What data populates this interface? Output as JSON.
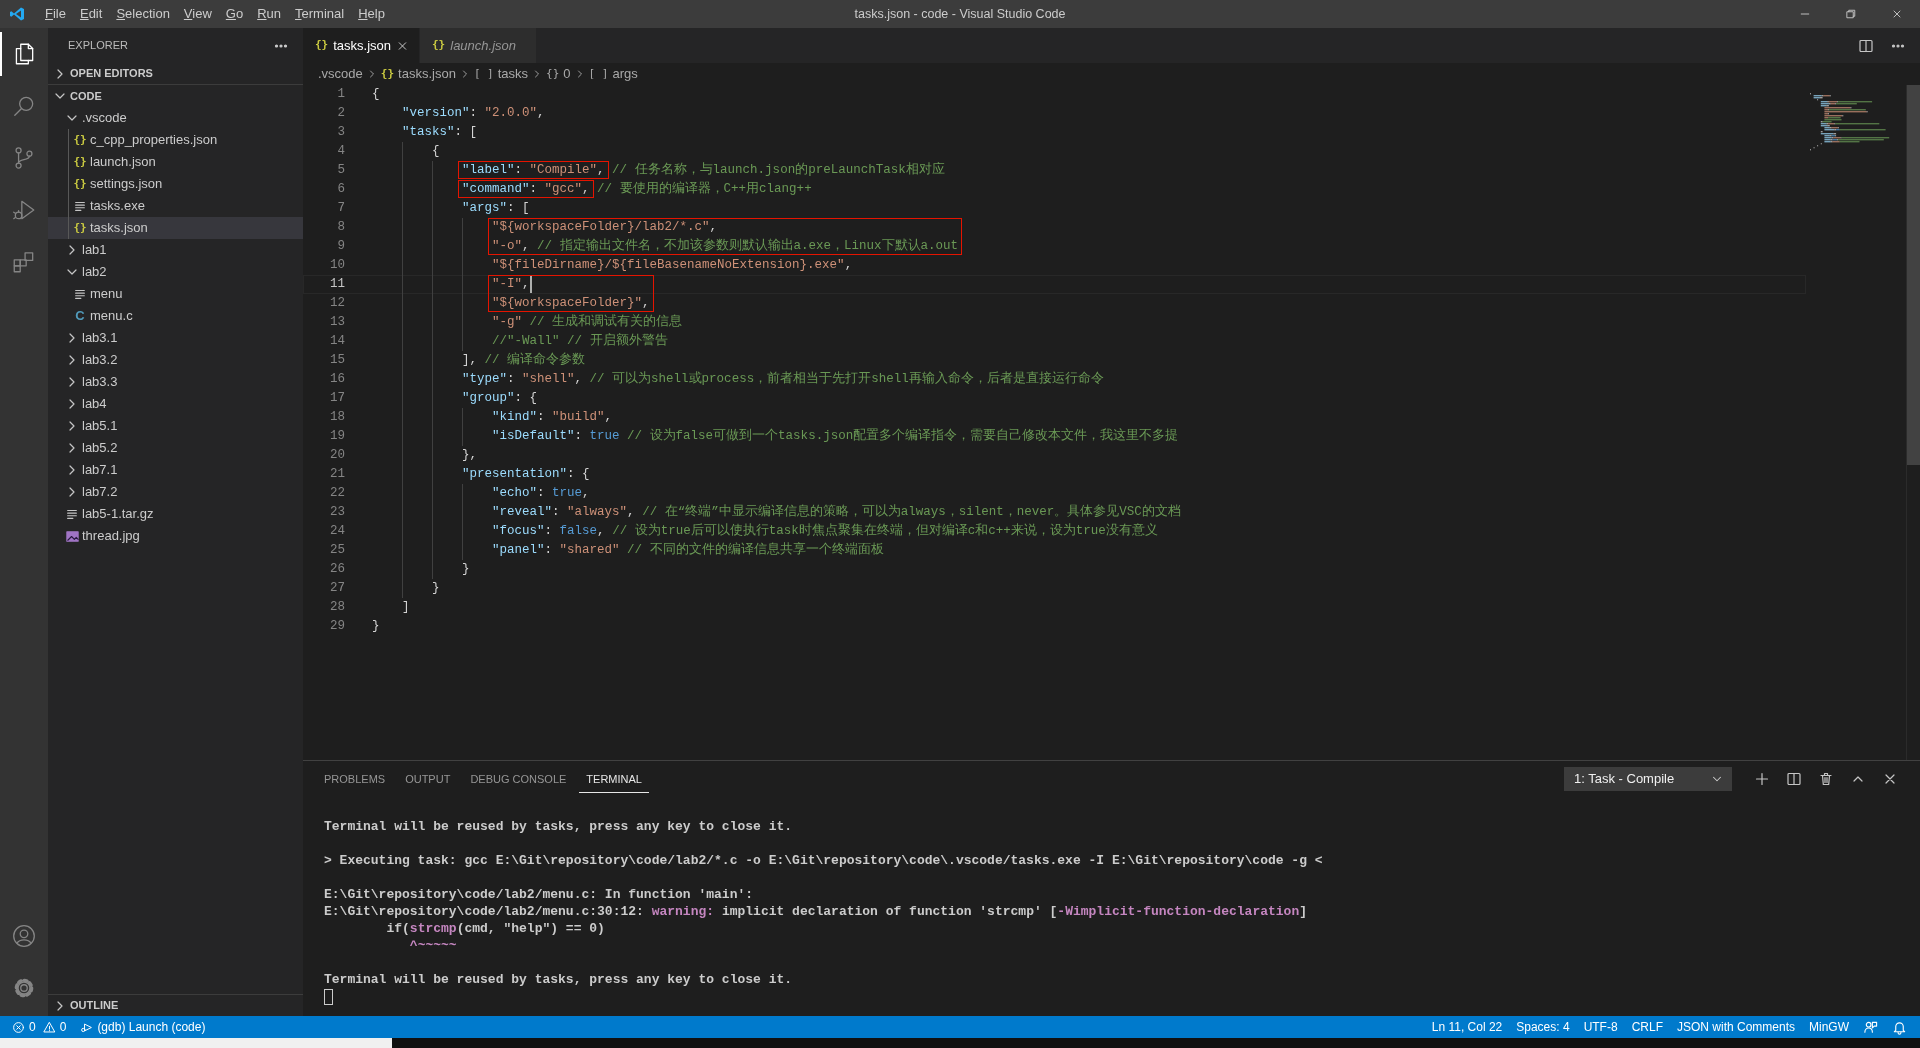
{
  "window": {
    "title": "tasks.json - code - Visual Studio Code"
  },
  "menu": [
    "File",
    "Edit",
    "Selection",
    "View",
    "Go",
    "Run",
    "Terminal",
    "Help"
  ],
  "activity_bar": [
    {
      "kind": "explorer",
      "selected": true
    },
    {
      "kind": "search",
      "selected": false
    },
    {
      "kind": "source-control",
      "selected": false
    },
    {
      "kind": "run",
      "selected": false
    },
    {
      "kind": "extensions",
      "selected": false
    }
  ],
  "activity_bar_bottom": [
    {
      "kind": "account"
    },
    {
      "kind": "settings"
    }
  ],
  "sidebar": {
    "title": "EXPLORER",
    "sections": [
      {
        "title": "OPEN EDITORS",
        "expanded": false
      },
      {
        "title": "CODE",
        "expanded": true,
        "items": [
          {
            "kind": "folder",
            "label": ".vscode",
            "expanded": true,
            "selected": false,
            "children": [
              {
                "kind": "json",
                "icon": "{}",
                "label": "c_cpp_properties.json",
                "selected": false
              },
              {
                "kind": "json",
                "icon": "{}",
                "label": "launch.json",
                "selected": false
              },
              {
                "kind": "json",
                "icon": "{}",
                "label": "settings.json",
                "selected": false
              },
              {
                "kind": "text",
                "label": "tasks.exe",
                "selected": false
              },
              {
                "kind": "json",
                "icon": "{}",
                "label": "tasks.json",
                "selected": true
              }
            ]
          },
          {
            "kind": "folder",
            "label": "lab1",
            "expanded": false,
            "selected": false
          },
          {
            "kind": "folder",
            "label": "lab2",
            "expanded": true,
            "selected": false,
            "children": [
              {
                "kind": "text",
                "label": "menu",
                "selected": false
              },
              {
                "kind": "c",
                "icon": "C",
                "label": "menu.c",
                "selected": false
              }
            ]
          },
          {
            "kind": "folder",
            "label": "lab3.1",
            "expanded": false,
            "selected": false
          },
          {
            "kind": "folder",
            "label": "lab3.2",
            "expanded": false,
            "selected": false
          },
          {
            "kind": "folder",
            "label": "lab3.3",
            "expanded": false,
            "selected": false
          },
          {
            "kind": "folder",
            "label": "lab4",
            "expanded": false,
            "selected": false
          },
          {
            "kind": "folder",
            "label": "lab5.1",
            "expanded": false,
            "selected": false
          },
          {
            "kind": "folder",
            "label": "lab5.2",
            "expanded": false,
            "selected": false
          },
          {
            "kind": "folder",
            "label": "lab7.1",
            "expanded": false,
            "selected": false
          },
          {
            "kind": "folder",
            "label": "lab7.2",
            "expanded": false,
            "selected": false
          },
          {
            "kind": "text",
            "label": "lab5-1.tar.gz",
            "selected": false
          },
          {
            "kind": "image",
            "label": "thread.jpg",
            "selected": false
          }
        ]
      }
    ],
    "bottom_section": {
      "title": "OUTLINE",
      "expanded": false
    }
  },
  "tabs": [
    {
      "icon": "{}",
      "label": "tasks.json",
      "selected": true,
      "preview": false
    },
    {
      "icon": "{}",
      "label": "launch.json",
      "selected": false,
      "preview": true
    }
  ],
  "breadcrumbs": [
    {
      "kind": "folder",
      "label": ".vscode"
    },
    {
      "kind": "json",
      "icon": "{}",
      "label": "tasks.json"
    },
    {
      "kind": "array",
      "icon": "[ ]",
      "label": "tasks"
    },
    {
      "kind": "object",
      "icon": "{}",
      "label": "0"
    },
    {
      "kind": "array",
      "icon": "[ ]",
      "label": "args"
    }
  ],
  "editor": {
    "lines": [
      {
        "number": "1",
        "current": false,
        "boxed": false,
        "tokens": [
          {
            "kind": "punct",
            "text": "{"
          }
        ]
      },
      {
        "number": "2",
        "current": false,
        "boxed": false,
        "tokens": [
          {
            "kind": "key",
            "text": "    \"version\""
          },
          {
            "kind": "punct",
            "text": ": "
          },
          {
            "kind": "string",
            "text": "\"2.0.0\""
          },
          {
            "kind": "punct",
            "text": ","
          }
        ]
      },
      {
        "number": "3",
        "current": false,
        "boxed": false,
        "tokens": [
          {
            "kind": "key",
            "text": "    \"tasks\""
          },
          {
            "kind": "punct",
            "text": ": ["
          }
        ]
      },
      {
        "number": "4",
        "current": false,
        "boxed": false,
        "tokens": [
          {
            "kind": "punct",
            "text": "        {"
          }
        ]
      },
      {
        "number": "5",
        "current": false,
        "boxed": true,
        "box_continues": false,
        "box_covers_comment": false,
        "tokens": [
          {
            "kind": "key",
            "text": "            \"label\""
          },
          {
            "kind": "punct",
            "text": ": "
          },
          {
            "kind": "string",
            "text": "\"Compile\""
          },
          {
            "kind": "punct",
            "text": ","
          },
          {
            "kind": "comment",
            "text": " // 任务名称，与launch.json的preLaunchTask相对应"
          }
        ]
      },
      {
        "number": "6",
        "current": false,
        "boxed": true,
        "box_continues": false,
        "box_covers_comment": false,
        "tokens": [
          {
            "kind": "key",
            "text": "            \"command\""
          },
          {
            "kind": "punct",
            "text": ": "
          },
          {
            "kind": "string",
            "text": "\"gcc\""
          },
          {
            "kind": "punct",
            "text": ","
          },
          {
            "kind": "comment",
            "text": " // 要使用的编译器，C++用clang++"
          }
        ]
      },
      {
        "number": "7",
        "current": false,
        "boxed": false,
        "tokens": [
          {
            "kind": "key",
            "text": "            \"args\""
          },
          {
            "kind": "punct",
            "text": ": ["
          }
        ]
      },
      {
        "number": "8",
        "current": false,
        "boxed": true,
        "box_continues": false,
        "tokens": [
          {
            "kind": "string",
            "text": "                \"${workspaceFolder}/lab2/*.c\""
          },
          {
            "kind": "punct",
            "text": ","
          }
        ]
      },
      {
        "number": "9",
        "current": false,
        "boxed": true,
        "box_continues": true,
        "box_covers_comment": true,
        "tokens": [
          {
            "kind": "string",
            "text": "                \"-o\""
          },
          {
            "kind": "punct",
            "text": ","
          },
          {
            "kind": "comment",
            "text": " // 指定输出文件名，不加该参数则默认输出a.exe，Linux下默认a.out"
          }
        ]
      },
      {
        "number": "10",
        "current": false,
        "boxed": false,
        "tokens": [
          {
            "kind": "string",
            "text": "                \"${fileDirname}/${fileBasenameNoExtension}.exe\""
          },
          {
            "kind": "punct",
            "text": ","
          }
        ]
      },
      {
        "number": "11",
        "current": true,
        "boxed": true,
        "box_continues": false,
        "tokens": [
          {
            "kind": "string",
            "text": "                \"-I\""
          },
          {
            "kind": "punct",
            "text": ","
          }
        ]
      },
      {
        "number": "12",
        "current": false,
        "boxed": true,
        "box_continues": true,
        "tokens": [
          {
            "kind": "string",
            "text": "                \"${workspaceFolder}\""
          },
          {
            "kind": "punct",
            "text": ","
          }
        ]
      },
      {
        "number": "13",
        "current": false,
        "boxed": false,
        "tokens": [
          {
            "kind": "string",
            "text": "                \"-g\""
          },
          {
            "kind": "comment",
            "text": " // 生成和调试有关的信息"
          }
        ]
      },
      {
        "number": "14",
        "current": false,
        "boxed": false,
        "tokens": [
          {
            "kind": "comment",
            "text": "                //\"-Wall\" // 开启额外警告"
          }
        ]
      },
      {
        "number": "15",
        "current": false,
        "boxed": false,
        "tokens": [
          {
            "kind": "punct",
            "text": "            ],"
          },
          {
            "kind": "comment",
            "text": " // 编译命令参数"
          }
        ]
      },
      {
        "number": "16",
        "current": false,
        "boxed": false,
        "tokens": [
          {
            "kind": "key",
            "text": "            \"type\""
          },
          {
            "kind": "punct",
            "text": ": "
          },
          {
            "kind": "string",
            "text": "\"shell\""
          },
          {
            "kind": "punct",
            "text": ","
          },
          {
            "kind": "comment",
            "text": " // 可以为shell或process，前者相当于先打开shell再输入命令，后者是直接运行命令"
          }
        ]
      },
      {
        "number": "17",
        "current": false,
        "boxed": false,
        "tokens": [
          {
            "kind": "key",
            "text": "            \"group\""
          },
          {
            "kind": "punct",
            "text": ": {"
          }
        ]
      },
      {
        "number": "18",
        "current": false,
        "boxed": false,
        "tokens": [
          {
            "kind": "key",
            "text": "                \"kind\""
          },
          {
            "kind": "punct",
            "text": ": "
          },
          {
            "kind": "string",
            "text": "\"build\""
          },
          {
            "kind": "punct",
            "text": ","
          }
        ]
      },
      {
        "number": "19",
        "current": false,
        "boxed": false,
        "tokens": [
          {
            "kind": "key",
            "text": "                \"isDefault\""
          },
          {
            "kind": "punct",
            "text": ": "
          },
          {
            "kind": "literal",
            "text": "true"
          },
          {
            "kind": "comment",
            "text": " // 设为false可做到一个tasks.json配置多个编译指令，需要自己修改本文件，我这里不多提"
          }
        ]
      },
      {
        "number": "20",
        "current": false,
        "boxed": false,
        "tokens": [
          {
            "kind": "punct",
            "text": "            },"
          }
        ]
      },
      {
        "number": "21",
        "current": false,
        "boxed": false,
        "tokens": [
          {
            "kind": "key",
            "text": "            \"presentation\""
          },
          {
            "kind": "punct",
            "text": ": {"
          }
        ]
      },
      {
        "number": "22",
        "current": false,
        "boxed": false,
        "tokens": [
          {
            "kind": "key",
            "text": "                \"echo\""
          },
          {
            "kind": "punct",
            "text": ": "
          },
          {
            "kind": "literal",
            "text": "true"
          },
          {
            "kind": "punct",
            "text": ","
          }
        ]
      },
      {
        "number": "23",
        "current": false,
        "boxed": false,
        "tokens": [
          {
            "kind": "key",
            "text": "                \"reveal\""
          },
          {
            "kind": "punct",
            "text": ": "
          },
          {
            "kind": "string",
            "text": "\"always\""
          },
          {
            "kind": "punct",
            "text": ","
          },
          {
            "kind": "comment",
            "text": " // 在“终端”中显示编译信息的策略，可以为always，silent，never。具体参见VSC的文档"
          }
        ]
      },
      {
        "number": "24",
        "current": false,
        "boxed": false,
        "tokens": [
          {
            "kind": "key",
            "text": "                \"focus\""
          },
          {
            "kind": "punct",
            "text": ": "
          },
          {
            "kind": "literal",
            "text": "false"
          },
          {
            "kind": "punct",
            "text": ","
          },
          {
            "kind": "comment",
            "text": " // 设为true后可以使执行task时焦点聚集在终端，但对编译c和c++来说，设为true没有意义"
          }
        ]
      },
      {
        "number": "25",
        "current": false,
        "boxed": false,
        "tokens": [
          {
            "kind": "key",
            "text": "                \"panel\""
          },
          {
            "kind": "punct",
            "text": ": "
          },
          {
            "kind": "string",
            "text": "\"shared\""
          },
          {
            "kind": "comment",
            "text": " // 不同的文件的编译信息共享一个终端面板"
          }
        ]
      },
      {
        "number": "26",
        "current": false,
        "boxed": false,
        "tokens": [
          {
            "kind": "punct",
            "text": "            }"
          }
        ]
      },
      {
        "number": "27",
        "current": false,
        "boxed": false,
        "tokens": [
          {
            "kind": "punct",
            "text": "        }"
          }
        ]
      },
      {
        "number": "28",
        "current": false,
        "boxed": false,
        "tokens": [
          {
            "kind": "punct",
            "text": "    ]"
          }
        ]
      },
      {
        "number": "29",
        "current": false,
        "boxed": false,
        "tokens": [
          {
            "kind": "punct",
            "text": "}"
          }
        ]
      }
    ]
  },
  "panel": {
    "tabs": [
      {
        "label": "PROBLEMS",
        "selected": false
      },
      {
        "label": "OUTPUT",
        "selected": false
      },
      {
        "label": "DEBUG CONSOLE",
        "selected": false
      },
      {
        "label": "TERMINAL",
        "selected": true
      }
    ],
    "terminal_selector": "1: Task - Compile",
    "terminal_lines": [
      {
        "space_before": true,
        "segments": [
          {
            "kind": "plain",
            "text": "Terminal will be reused by tasks, press any key to close it."
          }
        ]
      },
      {
        "space_before": true,
        "segments": [
          {
            "kind": "plain",
            "text": "> Executing task: gcc E:\\Git\\repository\\code/lab2/*.c -o E:\\Git\\repository\\code\\.vscode/tasks.exe -I E:\\Git\\repository\\code -g <"
          }
        ]
      },
      {
        "space_before": true,
        "segments": [
          {
            "kind": "plain",
            "text": "E:\\Git\\repository\\code/lab2/menu.c: In function 'main':"
          }
        ]
      },
      {
        "space_before": false,
        "segments": [
          {
            "kind": "plain",
            "text": "E:\\Git\\repository\\code/lab2/menu.c:30:12: "
          },
          {
            "kind": "accent",
            "text": "warning:"
          },
          {
            "kind": "plain",
            "text": " implicit declaration of function 'strcmp' ["
          },
          {
            "kind": "accent",
            "text": "-Wimplicit-function-declaration"
          },
          {
            "kind": "plain",
            "text": "]"
          }
        ]
      },
      {
        "space_before": false,
        "segments": [
          {
            "kind": "plain",
            "text": "        if("
          },
          {
            "kind": "accent",
            "text": "strcmp"
          },
          {
            "kind": "plain",
            "text": "(cmd, \"help\") == 0)"
          }
        ]
      },
      {
        "space_before": false,
        "segments": [
          {
            "kind": "accent",
            "text": "           ^~~~~~"
          }
        ]
      },
      {
        "space_before": true,
        "segments": [
          {
            "kind": "plain",
            "text": "Terminal will be reused by tasks, press any key to close it."
          }
        ]
      }
    ],
    "terminal_cursor": true
  },
  "status_bar": {
    "errors": "0",
    "warnings": "0",
    "debug": "(gdb) Launch (code)",
    "right": [
      "Ln 11, Col 22",
      "Spaces: 4",
      "UTF-8",
      "CRLF",
      "JSON with Comments",
      "MinGW"
    ]
  }
}
